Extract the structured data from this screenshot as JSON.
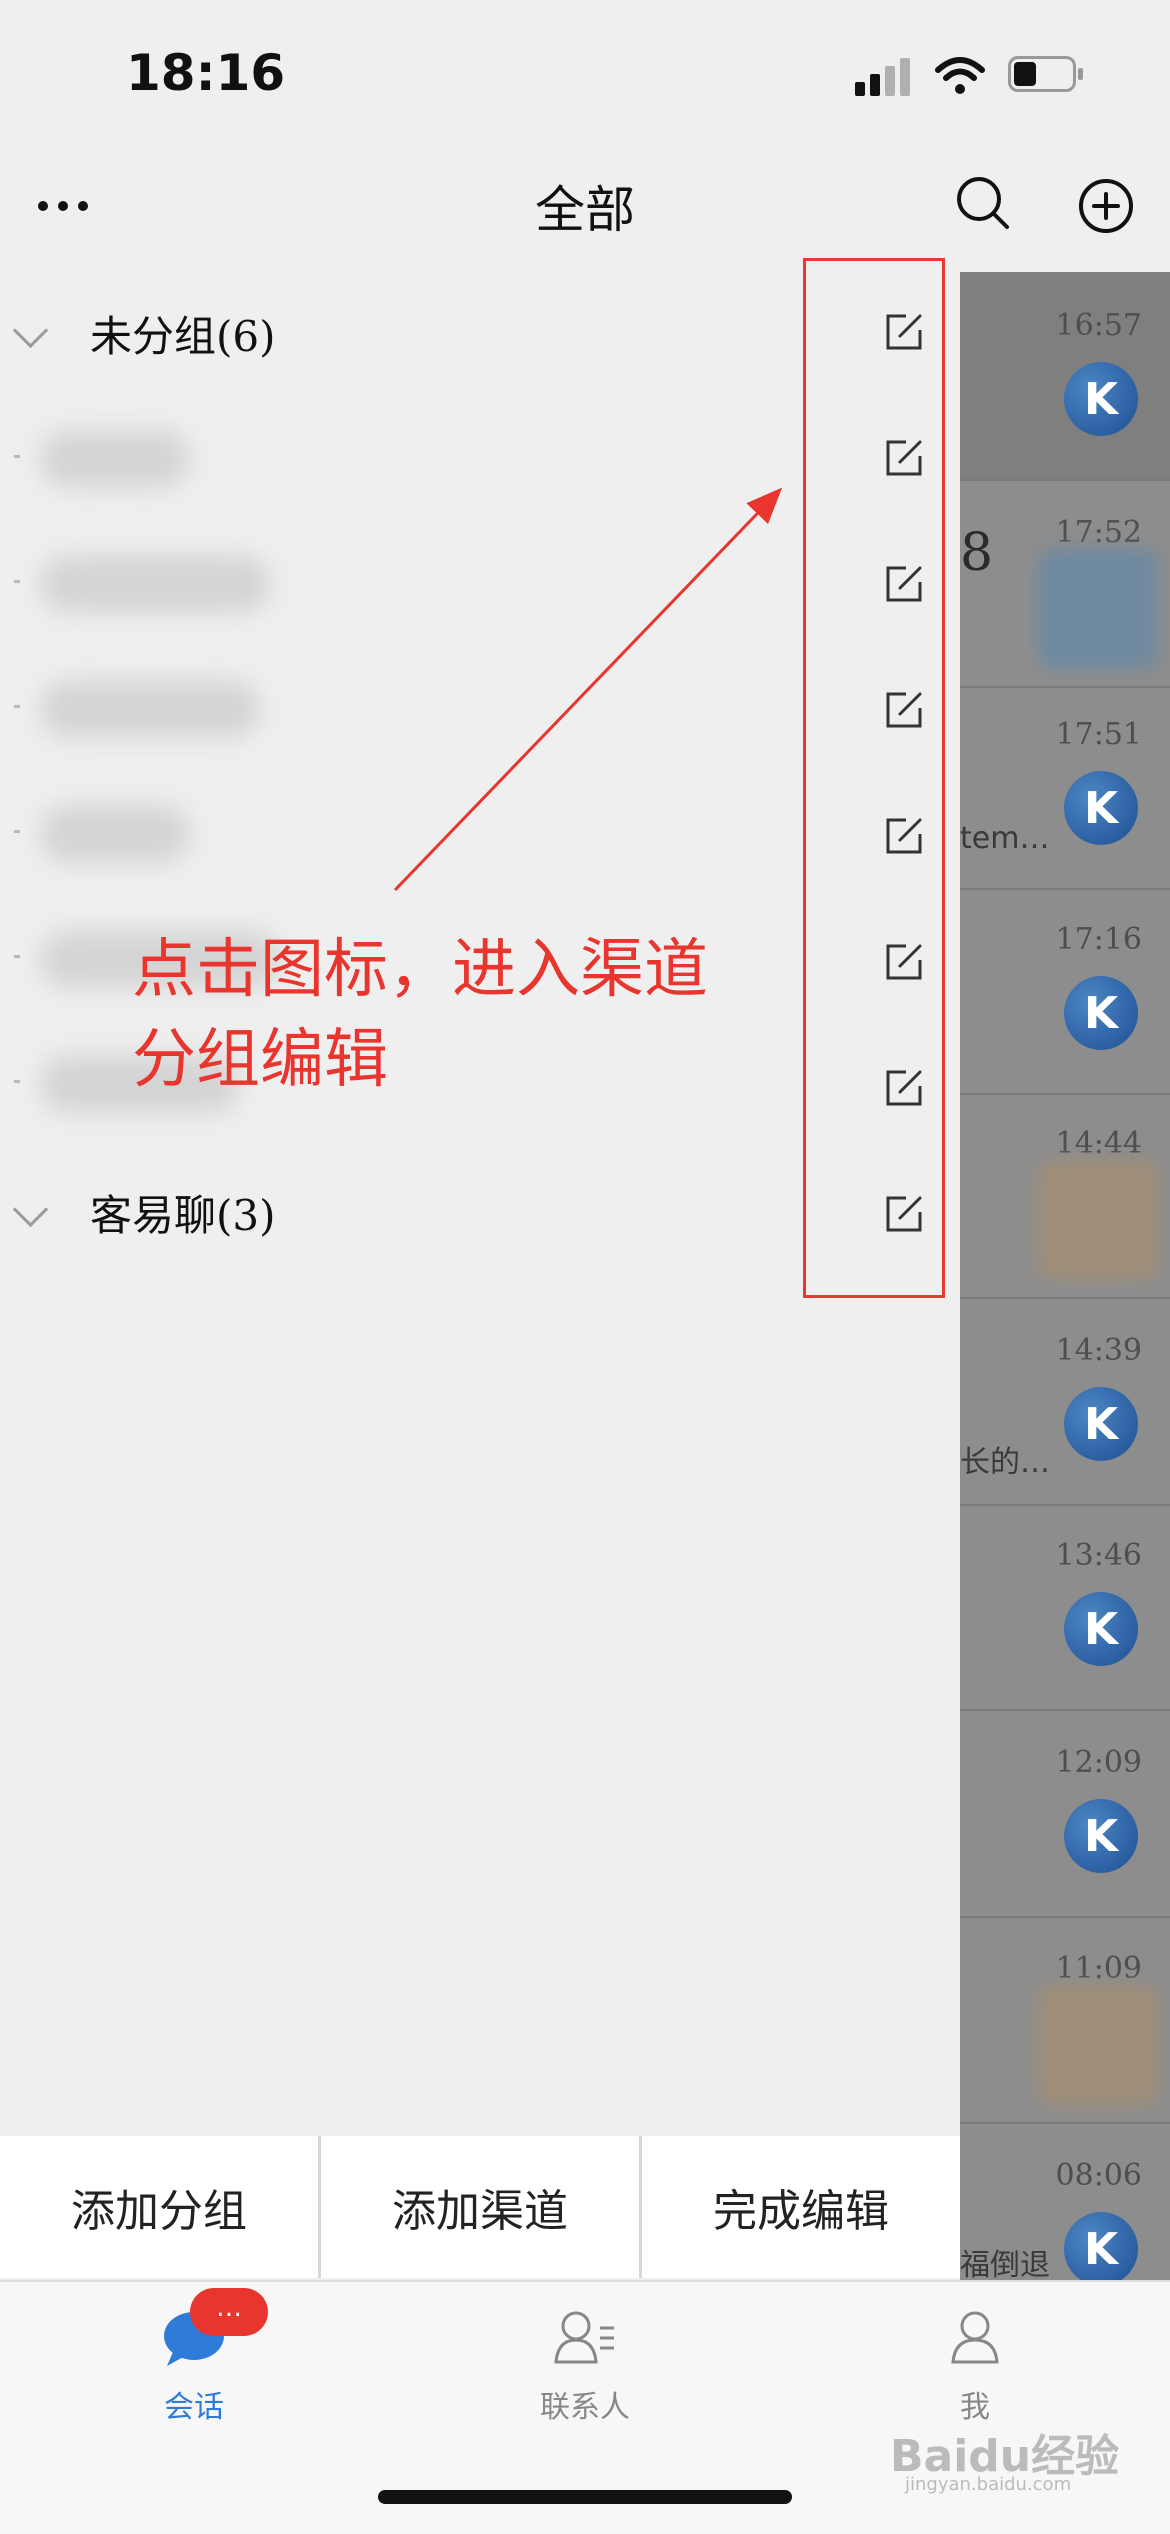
{
  "status_bar": {
    "time": "18:16"
  },
  "header": {
    "title": "全部"
  },
  "groups": [
    {
      "label": "未分组(6)"
    },
    {
      "label": "客易聊(3)"
    }
  ],
  "annotation": {
    "line1": "点击图标，进入渠道",
    "line2": "分组编辑"
  },
  "background_chats": [
    {
      "time": "16:57",
      "avatar": "kyl-logo",
      "snippet": ""
    },
    {
      "time": "17:52",
      "avatar": "blurred",
      "snippet": "",
      "peek": "8"
    },
    {
      "time": "17:51",
      "avatar": "kyl-logo",
      "snippet": "tem…"
    },
    {
      "time": "17:16",
      "avatar": "kyl-logo",
      "snippet": ""
    },
    {
      "time": "14:44",
      "avatar": "blurred",
      "snippet": ""
    },
    {
      "time": "14:39",
      "avatar": "kyl-logo",
      "snippet": "长的…"
    },
    {
      "time": "13:46",
      "avatar": "kyl-logo",
      "snippet": ""
    },
    {
      "time": "12:09",
      "avatar": "kyl-logo",
      "snippet": ""
    },
    {
      "time": "11:09",
      "avatar": "blurred",
      "snippet": ""
    },
    {
      "time": "08:06",
      "avatar": "kyl-logo",
      "snippet": "福倒退"
    }
  ],
  "actions": {
    "add_group": "添加分组",
    "add_channel": "添加渠道",
    "finish_edit": "完成编辑"
  },
  "tabs": {
    "chat": "会话",
    "contacts": "联系人",
    "me": "我",
    "badge": "…"
  },
  "watermark": {
    "brand": "Baidu经验",
    "url": "jingyan.baidu.com"
  },
  "colors": {
    "accent": "#2f7bd8",
    "annotation_red": "#e8352e",
    "overlay": "#8d8d8d"
  }
}
